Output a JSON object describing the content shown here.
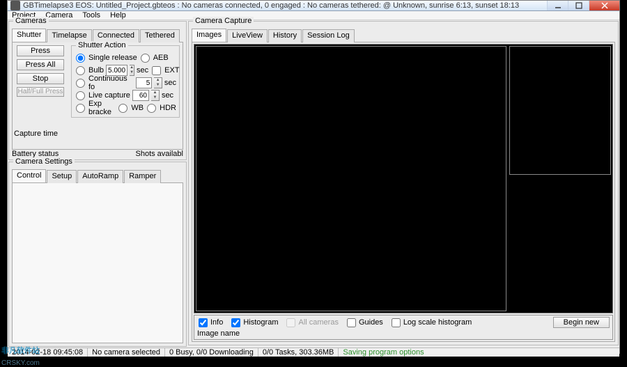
{
  "window": {
    "title": "GBTimelapse3 EOS: Untitled_Project.gbteos : No cameras connected, 0 engaged : No cameras tethered: @ Unknown, sunrise 6:13, sunset 18:13"
  },
  "menu": {
    "project": "Project",
    "camera": "Camera",
    "tools": "Tools",
    "help": "Help"
  },
  "cameras": {
    "legend": "Cameras",
    "tabs": {
      "shutter": "Shutter",
      "timelapse": "Timelapse",
      "connected": "Connected",
      "tethered": "Tethered"
    },
    "buttons": {
      "press": "Press",
      "pressAll": "Press All",
      "stop": "Stop",
      "halfFull": "Half/Full Press"
    },
    "labels": {
      "captureTime": "Capture time",
      "batteryStatus": "Battery status",
      "shotsAvail": "Shots availabl"
    },
    "shutter": {
      "legend": "Shutter Action",
      "single": "Single release",
      "aeb": "AEB",
      "bulb": "Bulb",
      "bulbVal": "5.000",
      "sec1": "sec",
      "ext": "EXT",
      "cont": "Continuous fo",
      "contVal": "5",
      "sec2": "sec",
      "live": "Live capture",
      "liveVal": "60",
      "sec3": "sec",
      "expb": "Exp bracke",
      "wb": "WB",
      "hdr": "HDR"
    }
  },
  "settings": {
    "legend": "Camera Settings",
    "tabs": {
      "control": "Control",
      "setup": "Setup",
      "autoramp": "AutoRamp",
      "ramper": "Ramper"
    }
  },
  "capture": {
    "legend": "Camera Capture",
    "tabs": {
      "images": "Images",
      "liveview": "LiveView",
      "history": "History",
      "session": "Session Log"
    },
    "checks": {
      "info": "Info",
      "histogram": "Histogram",
      "allcams": "All cameras",
      "guides": "Guides",
      "logscale": "Log scale histogram"
    },
    "begin": "Begin new",
    "imagename": "Image name"
  },
  "status": {
    "time": "2014-02-18 09:45:08",
    "cam": "No camera selected",
    "busy": "0 Busy, 0/0 Downloading",
    "tasks": "0/0 Tasks, 303.36MB",
    "saving": "Saving program options"
  },
  "watermark": {
    "cn": "非凡软件站",
    "sub": "CRSKY.com"
  }
}
